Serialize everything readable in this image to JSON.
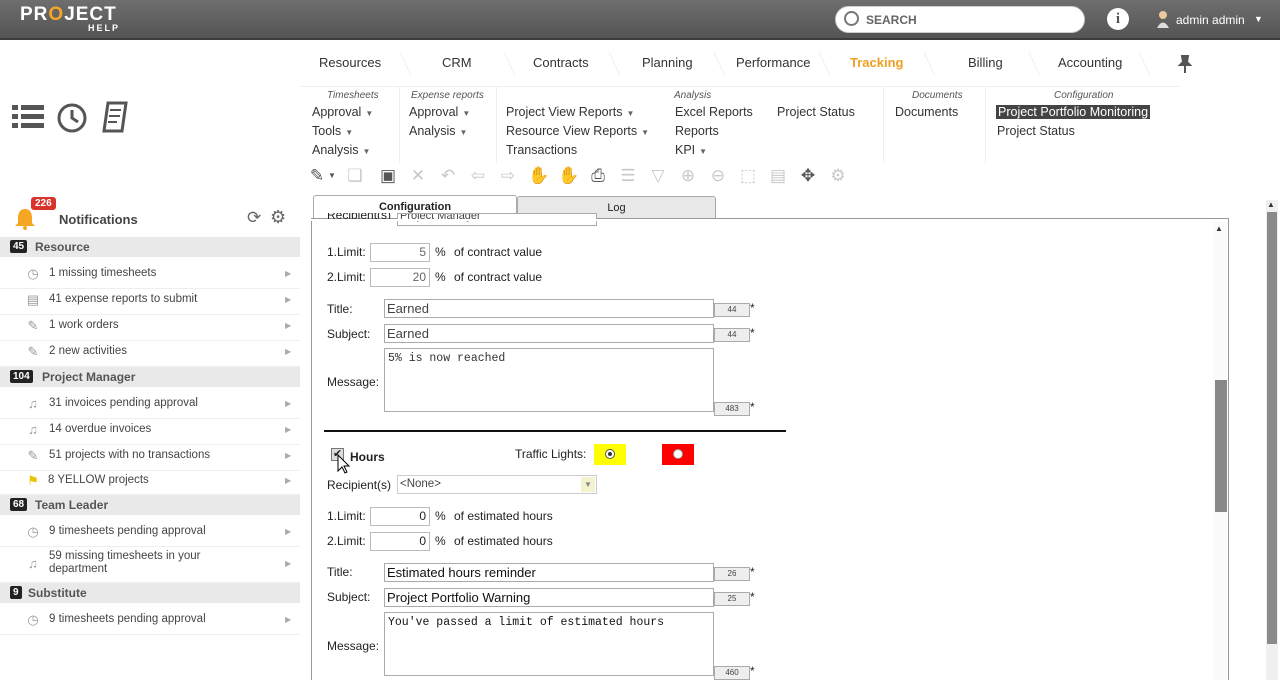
{
  "app": {
    "logo_pre": "PR",
    "logo_o": "O",
    "logo_post": "JECT",
    "logo_sub": "HELP"
  },
  "search": {
    "placeholder": "SEARCH"
  },
  "user": {
    "name": "admin admin"
  },
  "menu": {
    "items": [
      "Resources",
      "CRM",
      "Contracts",
      "Planning",
      "Performance",
      "Tracking",
      "Billing",
      "Accounting"
    ],
    "active": "Tracking"
  },
  "submenu": {
    "timesheets": {
      "head": "Timesheets",
      "items": [
        "Approval",
        "Tools",
        "Analysis"
      ]
    },
    "expense": {
      "head": "Expense reports",
      "items": [
        "Approval",
        "Analysis"
      ]
    },
    "reports": {
      "items": [
        "Project View Reports",
        "Resource View Reports",
        "Transactions"
      ]
    },
    "analysis": {
      "head": "Analysis",
      "items": [
        "Excel Reports",
        "Reports",
        "KPI",
        "Project Status"
      ]
    },
    "documents": {
      "head": "Documents",
      "items": [
        "Documents"
      ]
    },
    "configuration": {
      "head": "Configuration",
      "items": [
        "Project Portfolio Monitoring",
        "Project Status"
      ]
    }
  },
  "notifications": {
    "badge": "226",
    "title": "Notifications",
    "groups": [
      {
        "count": "45",
        "label": "Resource",
        "items": [
          "1 missing timesheets",
          "41 expense reports to submit",
          "1 work orders",
          "2 new activities"
        ]
      },
      {
        "count": "104",
        "label": "Project Manager",
        "items": [
          "31 invoices pending approval",
          "14 overdue invoices",
          "51 projects with no transactions",
          "8 YELLOW projects"
        ]
      },
      {
        "count": "68",
        "label": "Team Leader",
        "items": [
          "9 timesheets pending approval",
          "59 missing timesheets in your department"
        ]
      },
      {
        "count": "9",
        "label": "Substitute",
        "items": [
          "9 timesheets pending approval"
        ]
      }
    ]
  },
  "tabs": {
    "configuration": "Configuration",
    "log": "Log"
  },
  "form": {
    "recipients_label": "Recipient(s)",
    "recipients_top": "Project Manager",
    "limit1_label": "1.Limit:",
    "limit2_label": "2.Limit:",
    "pct": "%",
    "contract_value": "of contract value",
    "estimated_hours": "of estimated hours",
    "title_label": "Title:",
    "subject_label": "Subject:",
    "message_label": "Message:",
    "block1": {
      "limit1": "5",
      "limit2": "20",
      "title": "Earned",
      "title_count": "44",
      "subject": "Earned",
      "subject_count": "44",
      "message": "5% is now reached",
      "message_count": "483"
    },
    "hours_label": "Hours",
    "traffic_lights": "Traffic Lights:",
    "block2": {
      "recipients": "<None>",
      "limit1": "0",
      "limit2": "0",
      "title": "Estimated hours reminder",
      "title_count": "26",
      "subject": "Project Portfolio Warning",
      "subject_count": "25",
      "message": "You've passed a limit of estimated hours",
      "message_count": "460"
    },
    "required": "*"
  },
  "colors": {
    "accent": "#f0a020",
    "yellow": "#ffff00",
    "red": "#ff0000",
    "badge": "#d9342b"
  }
}
